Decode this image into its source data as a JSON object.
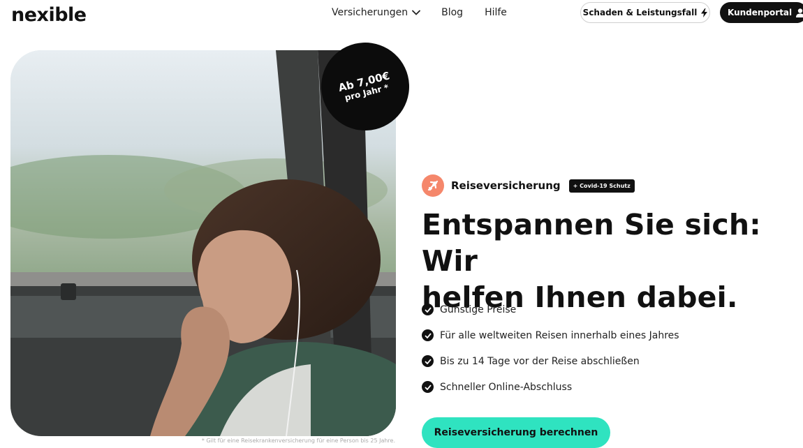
{
  "header": {
    "logo": "nexible",
    "nav": [
      {
        "label": "Versicherungen",
        "icon": "chevron-down-icon"
      },
      {
        "label": "Blog"
      },
      {
        "label": "Hilfe"
      }
    ],
    "claim_button": {
      "label": "Schaden & Leistungsfall",
      "icon": "lightning-icon"
    },
    "portal_button": {
      "label": "Kundenportal",
      "icon": "user-icon"
    }
  },
  "hero": {
    "price_badge": {
      "line1": "Ab 7,00€",
      "line2": "pro Jahr *"
    },
    "footnote": "* Gilt für eine Reisekrankenversicherung für eine Person bis 25 Jahre."
  },
  "product": {
    "name": "Reiseversicherung",
    "badge": "+ Covid-19 Schutz",
    "icon": "airplane-icon"
  },
  "headline": {
    "line1": "Entspannen Sie sich: Wir",
    "line2": "helfen Ihnen dabei."
  },
  "features": [
    "Günstige Preise",
    "Für alle weltweiten Reisen innerhalb eines Jahres",
    "Bis zu 14 Tage vor der Reise abschließen",
    "Schneller Online-Abschluss"
  ],
  "cta": {
    "label": "Reiseversicherung berechnen"
  },
  "colors": {
    "accent": "#2fe3c0",
    "product_icon_bg": "#f5876b",
    "dark": "#111111"
  }
}
